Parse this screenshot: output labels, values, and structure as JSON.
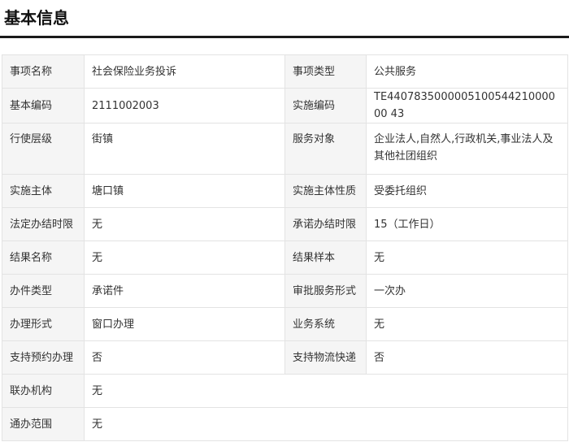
{
  "section": {
    "title": "基本信息"
  },
  "rows": [
    {
      "label1": "事项名称",
      "value1": "社会保险业务投诉",
      "label2": "事项类型",
      "value2": "公共服务"
    },
    {
      "label1": "基本编码",
      "value1": "2111002003",
      "label2": "实施编码",
      "value2": "TE440783500000510054421000000 43"
    },
    {
      "label1": "行使层级",
      "value1": "街镇",
      "label2": "服务对象",
      "value2": "企业法人,自然人,行政机关,事业法人及其他社团组织"
    },
    {
      "label1": "实施主体",
      "value1": "塘口镇",
      "label2": "实施主体性质",
      "value2": "受委托组织"
    },
    {
      "label1": "法定办结时限",
      "value1": "无",
      "label2": "承诺办结时限",
      "value2": "15（工作日）"
    },
    {
      "label1": "结果名称",
      "value1": "无",
      "label2": "结果样本",
      "value2": "无"
    },
    {
      "label1": "办件类型",
      "value1": "承诺件",
      "label2": "审批服务形式",
      "value2": "一次办"
    },
    {
      "label1": "办理形式",
      "value1": "窗口办理",
      "label2": "业务系统",
      "value2": "无"
    },
    {
      "label1": "支持预约办理",
      "value1": "否",
      "label2": "支持物流快递",
      "value2": "否"
    }
  ],
  "wide_rows": [
    {
      "label": "联办机构",
      "value": "无"
    },
    {
      "label": "通办范围",
      "value": "无"
    }
  ],
  "colors": {
    "label_bg": "#f5f5f5",
    "border": "#e3e3e3",
    "rule": "#1a1a1a"
  }
}
